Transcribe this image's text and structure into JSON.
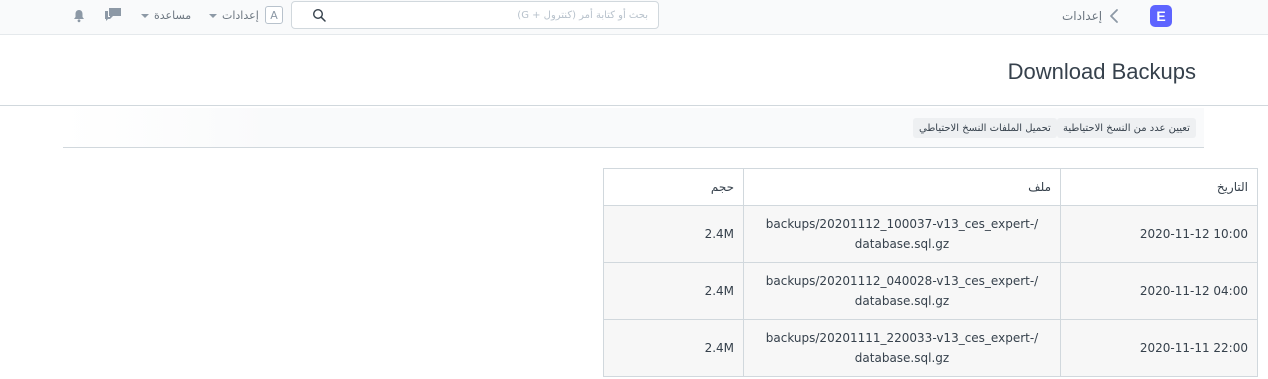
{
  "navbar": {
    "logo_letter": "E",
    "breadcrumb": "إعدادات",
    "search_placeholder": "بحث أو كتابة أمر (كنترول + G)",
    "avatar_letter": "A",
    "settings_label": "إعدادات",
    "help_label": "مساعدة",
    "icons": [
      "bell-icon",
      "chat-icon",
      "search-icon",
      "chevron-left-icon"
    ]
  },
  "page": {
    "title": "Download Backups"
  },
  "toolbar": {
    "set_count_label": "تعيين عدد من النسخ الاحتياطية",
    "download_files_label": "تحميل الملفات النسخ الاحتياطي"
  },
  "table": {
    "headers": {
      "date": "التاريخ",
      "file": "ملف",
      "size": "حجم"
    },
    "rows": [
      {
        "date": "2020-11-12 10:00",
        "file_line1": "backups/20201112_100037-v13_ces_expert-/",
        "file_line2": "database.sql.gz",
        "size": "2.4M"
      },
      {
        "date": "2020-11-12 04:00",
        "file_line1": "backups/20201112_040028-v13_ces_expert-/",
        "file_line2": "database.sql.gz",
        "size": "2.4M"
      },
      {
        "date": "2020-11-11 22:00",
        "file_line1": "backups/20201111_220033-v13_ces_expert-/",
        "file_line2": "database.sql.gz",
        "size": "2.4M"
      }
    ]
  },
  "colors": {
    "brand": "#5e64ff",
    "navbar_bg": "#f9fafb",
    "row_bg": "#f7f7f7",
    "border": "#d1d8dd"
  }
}
